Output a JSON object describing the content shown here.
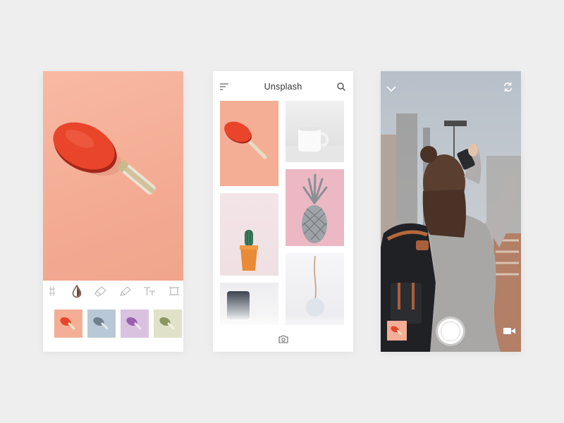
{
  "screens": {
    "editor": {
      "tools": [
        "crop-icon",
        "color-drop-icon",
        "eraser-icon",
        "brush-icon",
        "text-icon",
        "frame-icon"
      ],
      "filters": [
        {
          "name": "original-filter",
          "color": "#f5ae96"
        },
        {
          "name": "blue-filter",
          "color": "#b8c8d6"
        },
        {
          "name": "purple-filter",
          "color": "#d9c2e0"
        },
        {
          "name": "green-filter",
          "color": "#dfe2c8"
        }
      ]
    },
    "feed": {
      "title": "Unsplash",
      "icons": [
        "menu-icon",
        "search-icon",
        "camera-icon"
      ]
    },
    "camera": {
      "icons": [
        "chevron-down-icon",
        "switch-camera-icon",
        "video-icon"
      ]
    }
  },
  "colors": {
    "background": "#eeeeef",
    "accent_peach": "#f5ae96",
    "paddle_red": "#e7432a"
  }
}
